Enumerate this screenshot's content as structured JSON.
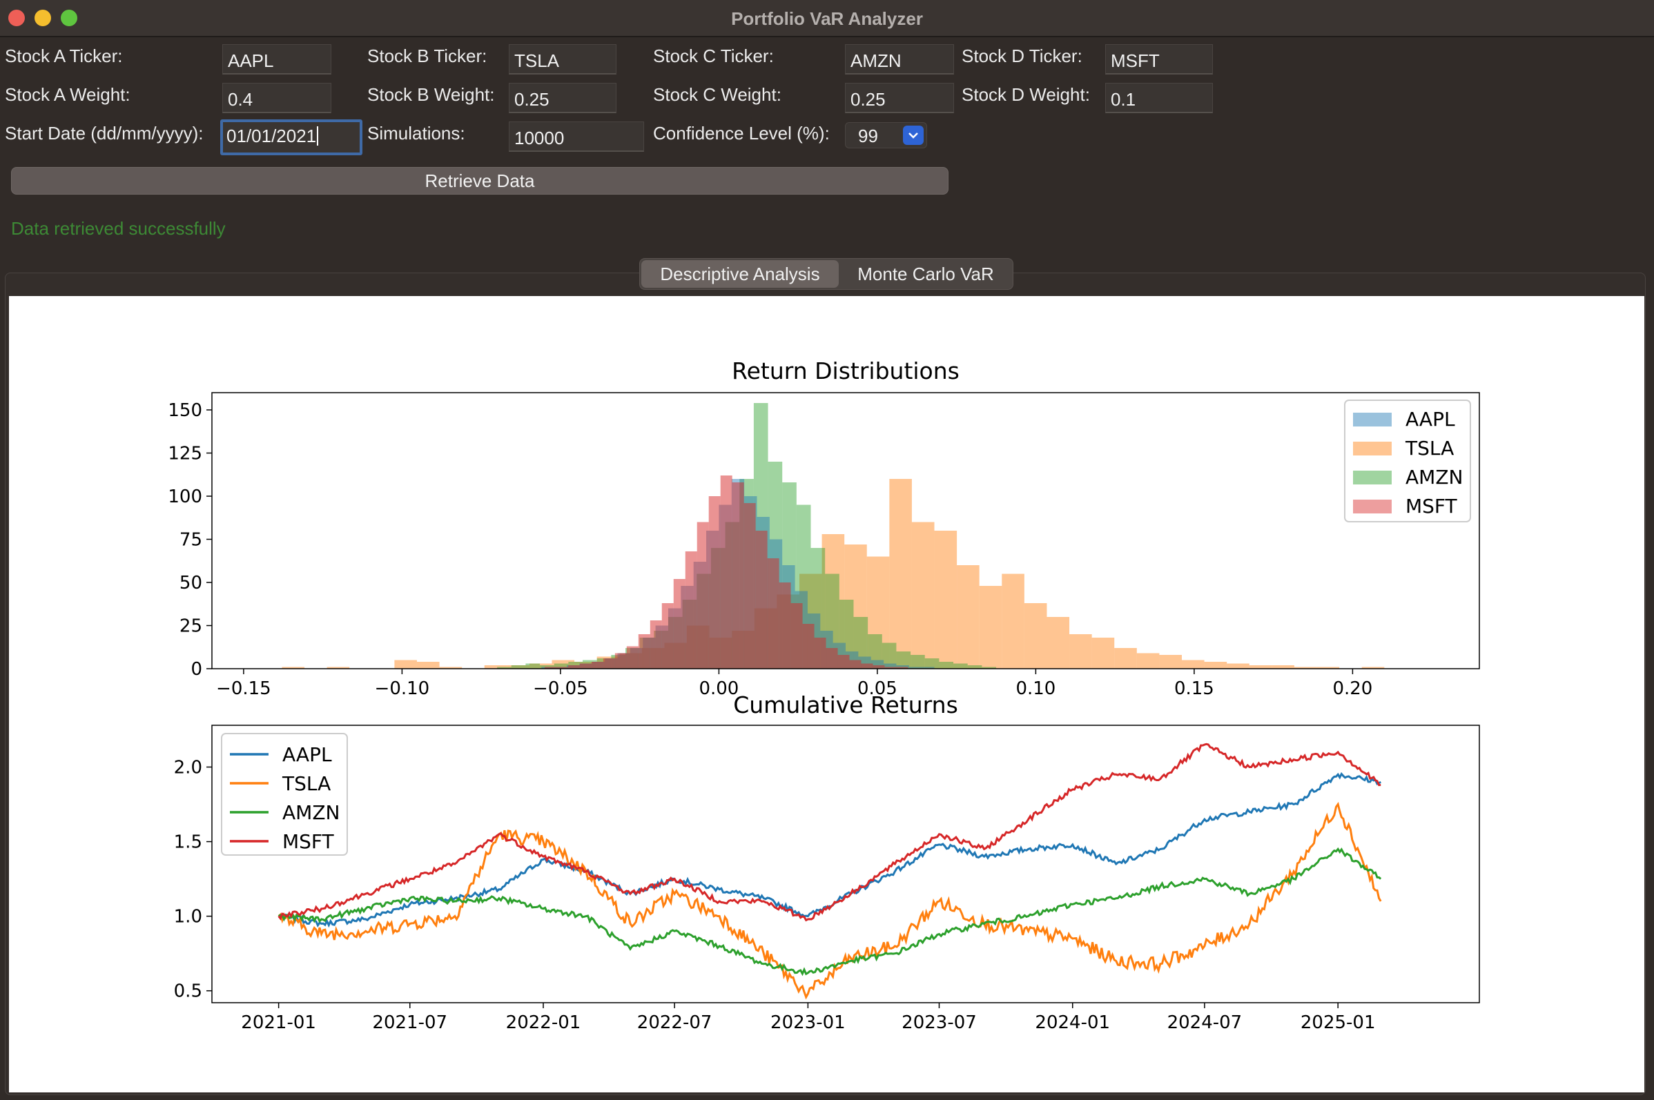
{
  "window": {
    "title": "Portfolio VaR Analyzer"
  },
  "form": {
    "stock_a_ticker_label": "Stock A Ticker:",
    "stock_a_ticker": "AAPL",
    "stock_b_ticker_label": "Stock B Ticker:",
    "stock_b_ticker": "TSLA",
    "stock_c_ticker_label": "Stock C Ticker:",
    "stock_c_ticker": "AMZN",
    "stock_d_ticker_label": "Stock D Ticker:",
    "stock_d_ticker": "MSFT",
    "stock_a_weight_label": "Stock A Weight:",
    "stock_a_weight": "0.4",
    "stock_b_weight_label": "Stock B Weight:",
    "stock_b_weight": "0.25",
    "stock_c_weight_label": "Stock C Weight:",
    "stock_c_weight": "0.25",
    "stock_d_weight_label": "Stock D Weight:",
    "stock_d_weight": "0.1",
    "start_date_label": "Start Date (dd/mm/yyyy):",
    "start_date": "01/01/2021",
    "simulations_label": "Simulations:",
    "simulations": "10000",
    "confidence_label": "Confidence Level (%):",
    "confidence": "99",
    "retrieve_button": "Retrieve Data",
    "status": "Data retrieved successfully"
  },
  "tabs": [
    {
      "label": "Descriptive Analysis",
      "active": true
    },
    {
      "label": "Monte Carlo VaR",
      "active": false
    }
  ],
  "colors": {
    "AAPL": "#1f77b4",
    "TSLA": "#ff7f0e",
    "AMZN": "#2ca02c",
    "MSFT": "#d62728",
    "status": "#3d8a35",
    "focus": "#3f6aa7"
  },
  "chart_data": [
    {
      "type": "bar",
      "subtype": "overlaid histogram",
      "title": "Return Distributions",
      "xlim": [
        -0.16,
        0.24
      ],
      "ylim": [
        0,
        160
      ],
      "x_ticks": [
        "−0.15",
        "−0.10",
        "−0.05",
        "0.00",
        "0.05",
        "0.10",
        "0.15",
        "0.20"
      ],
      "y_ticks": [
        "0",
        "25",
        "50",
        "75",
        "100",
        "125",
        "150"
      ],
      "legend": [
        "AAPL",
        "TSLA",
        "AMZN",
        "MSFT"
      ],
      "legend_position": "upper right",
      "series": [
        {
          "name": "TSLA",
          "bin_width": 0.0071,
          "start": -0.145,
          "counts": [
            0,
            1,
            0,
            1,
            0,
            0,
            5,
            4,
            1,
            0,
            2,
            2,
            3,
            5,
            4,
            7,
            9,
            12,
            15,
            25,
            18,
            22,
            35,
            43,
            55,
            78,
            72,
            65,
            110,
            85,
            80,
            60,
            48,
            55,
            38,
            30,
            20,
            18,
            12,
            9,
            8,
            5,
            4,
            3,
            2,
            2,
            1,
            1,
            0,
            1
          ]
        },
        {
          "name": "AMZN",
          "bin_width": 0.0045,
          "start": -0.07,
          "counts": [
            1,
            2,
            3,
            2,
            3,
            4,
            5,
            6,
            8,
            12,
            18,
            22,
            30,
            40,
            55,
            70,
            85,
            110,
            154,
            120,
            108,
            95,
            70,
            55,
            40,
            30,
            20,
            15,
            10,
            8,
            6,
            4,
            3,
            2,
            1
          ]
        },
        {
          "name": "AAPL",
          "bin_width": 0.004,
          "start": -0.06,
          "counts": [
            0,
            1,
            1,
            2,
            3,
            4,
            6,
            9,
            12,
            18,
            25,
            35,
            48,
            62,
            80,
            95,
            110,
            100,
            88,
            75,
            60,
            45,
            32,
            22,
            15,
            10,
            7,
            5,
            3,
            2,
            1,
            1
          ]
        },
        {
          "name": "MSFT",
          "bin_width": 0.0037,
          "start": -0.055,
          "counts": [
            1,
            1,
            2,
            3,
            4,
            6,
            9,
            13,
            20,
            28,
            38,
            52,
            68,
            85,
            100,
            112,
            108,
            96,
            80,
            64,
            50,
            38,
            26,
            18,
            12,
            8,
            5,
            3,
            2,
            1,
            1
          ]
        }
      ]
    },
    {
      "type": "line",
      "title": "Cumulative Returns",
      "x_ticks": [
        "2021-01",
        "2021-07",
        "2022-01",
        "2022-07",
        "2023-01",
        "2023-07",
        "2024-01",
        "2024-07",
        "2025-01"
      ],
      "y_ticks": [
        "0.5",
        "1.0",
        "1.5",
        "2.0"
      ],
      "ylim": [
        0.42,
        2.28
      ],
      "legend": [
        "AAPL",
        "TSLA",
        "AMZN",
        "MSFT"
      ],
      "legend_position": "upper left",
      "x": [
        "2021-01",
        "2021-03",
        "2021-05",
        "2021-07",
        "2021-09",
        "2021-11",
        "2022-01",
        "2022-03",
        "2022-05",
        "2022-07",
        "2022-09",
        "2022-11",
        "2023-01",
        "2023-03",
        "2023-05",
        "2023-07",
        "2023-09",
        "2023-11",
        "2024-01",
        "2024-03",
        "2024-05",
        "2024-07",
        "2024-09",
        "2024-11",
        "2025-01",
        "2025-03"
      ],
      "series": [
        {
          "name": "AAPL",
          "values": [
            1.0,
            0.95,
            0.98,
            1.08,
            1.12,
            1.18,
            1.38,
            1.3,
            1.15,
            1.25,
            1.18,
            1.12,
            1.0,
            1.15,
            1.3,
            1.48,
            1.4,
            1.45,
            1.48,
            1.35,
            1.45,
            1.65,
            1.7,
            1.75,
            1.95,
            1.9
          ]
        },
        {
          "name": "TSLA",
          "values": [
            1.0,
            0.88,
            0.9,
            0.95,
            1.0,
            1.55,
            1.5,
            1.3,
            0.95,
            1.15,
            1.0,
            0.75,
            0.48,
            0.72,
            0.8,
            1.1,
            0.95,
            0.9,
            0.85,
            0.7,
            0.68,
            0.8,
            0.95,
            1.3,
            1.75,
            1.1
          ]
        },
        {
          "name": "AMZN",
          "values": [
            1.0,
            0.98,
            1.05,
            1.12,
            1.1,
            1.12,
            1.05,
            1.0,
            0.78,
            0.9,
            0.8,
            0.68,
            0.62,
            0.7,
            0.75,
            0.88,
            0.95,
            1.0,
            1.08,
            1.12,
            1.2,
            1.25,
            1.15,
            1.25,
            1.45,
            1.25
          ]
        },
        {
          "name": "MSFT",
          "values": [
            1.0,
            1.05,
            1.15,
            1.25,
            1.35,
            1.55,
            1.4,
            1.3,
            1.15,
            1.25,
            1.1,
            1.1,
            0.98,
            1.15,
            1.35,
            1.55,
            1.45,
            1.65,
            1.85,
            1.95,
            1.92,
            2.15,
            2.0,
            2.05,
            2.1,
            1.88
          ]
        }
      ]
    }
  ]
}
